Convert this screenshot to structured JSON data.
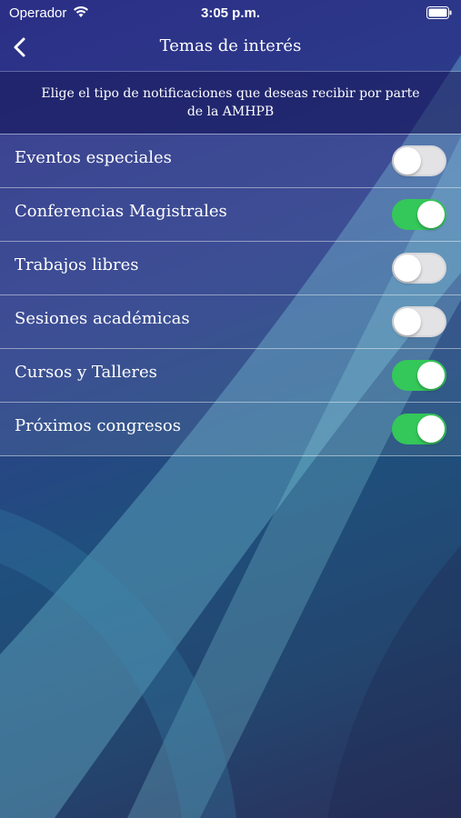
{
  "status_bar": {
    "carrier": "Operador",
    "time": "3:05 p.m.",
    "wifi_icon": "wifi-icon",
    "battery_icon": "battery-icon"
  },
  "nav": {
    "title": "Temas de interés",
    "back_icon": "chevron-left-icon"
  },
  "banner": {
    "text": "Elige el tipo de notificaciones que deseas recibir por parte de la AMHPB"
  },
  "topics": [
    {
      "label": "Eventos especiales",
      "enabled": false
    },
    {
      "label": "Conferencias Magistrales",
      "enabled": true
    },
    {
      "label": "Trabajos libres",
      "enabled": false
    },
    {
      "label": "Sesiones académicas",
      "enabled": false
    },
    {
      "label": "Cursos y Talleres",
      "enabled": true
    },
    {
      "label": "Próximos congresos",
      "enabled": true
    }
  ],
  "colors": {
    "toggle_on": "#34c759",
    "toggle_off": "#e3e3e6",
    "background": "#2b2f86"
  }
}
